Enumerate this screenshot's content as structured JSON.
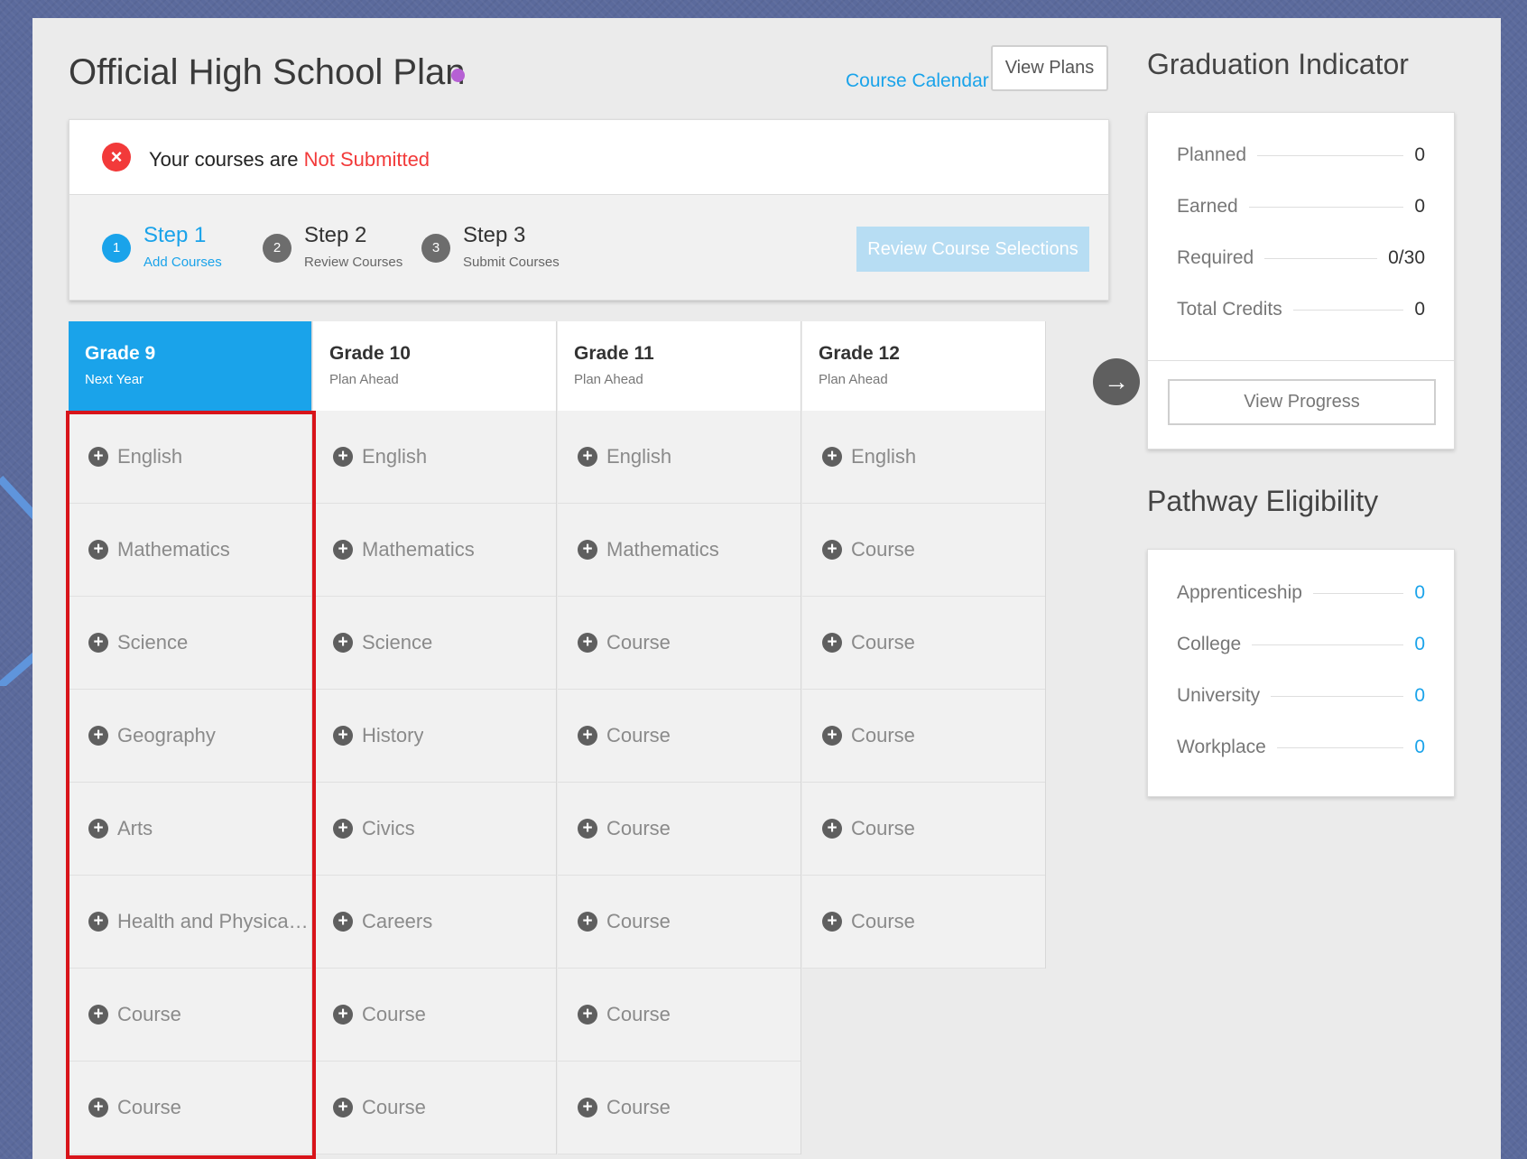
{
  "header": {
    "title": "Official High School Plan",
    "course_calendar": "Course Calendar",
    "view_plans": "View Plans"
  },
  "status": {
    "prefix": "Your courses are",
    "value": "Not Submitted",
    "error_glyph": "×"
  },
  "steps": [
    {
      "num": "1",
      "title": "Step 1",
      "sub": "Add Courses"
    },
    {
      "num": "2",
      "title": "Step 2",
      "sub": "Review Courses"
    },
    {
      "num": "3",
      "title": "Step 3",
      "sub": "Submit Courses"
    }
  ],
  "review_button": "Review Course Selections",
  "grades": [
    {
      "title": "Grade 9",
      "sub": "Next Year",
      "courses": [
        "English",
        "Mathematics",
        "Science",
        "Geography",
        "Arts",
        "Health and Physical Education",
        "Course",
        "Course"
      ]
    },
    {
      "title": "Grade 10",
      "sub": "Plan Ahead",
      "courses": [
        "English",
        "Mathematics",
        "Science",
        "History",
        "Civics",
        "Careers",
        "Course",
        "Course"
      ]
    },
    {
      "title": "Grade 11",
      "sub": "Plan Ahead",
      "courses": [
        "English",
        "Mathematics",
        "Course",
        "Course",
        "Course",
        "Course",
        "Course",
        "Course"
      ]
    },
    {
      "title": "Grade 12",
      "sub": "Plan Ahead",
      "courses": [
        "English",
        "Course",
        "Course",
        "Course",
        "Course",
        "Course"
      ]
    }
  ],
  "graduation": {
    "heading": "Graduation Indicator",
    "metrics": [
      {
        "label": "Planned",
        "value": "0"
      },
      {
        "label": "Earned",
        "value": "0"
      },
      {
        "label": "Required",
        "value": "0/30"
      },
      {
        "label": "Total Credits",
        "value": "0"
      }
    ],
    "view_progress": "View Progress"
  },
  "pathway": {
    "heading": "Pathway Eligibility",
    "metrics": [
      {
        "label": "Apprenticeship",
        "value": "0"
      },
      {
        "label": "College",
        "value": "0"
      },
      {
        "label": "University",
        "value": "0"
      },
      {
        "label": "Workplace",
        "value": "0"
      }
    ]
  },
  "icons": {
    "plus": "+",
    "arrow_right": "→"
  },
  "colors": {
    "accent": "#1aa3ea",
    "error": "#f23a3a",
    "annotation": "#d8141a",
    "status_dot": "#b660d4"
  }
}
